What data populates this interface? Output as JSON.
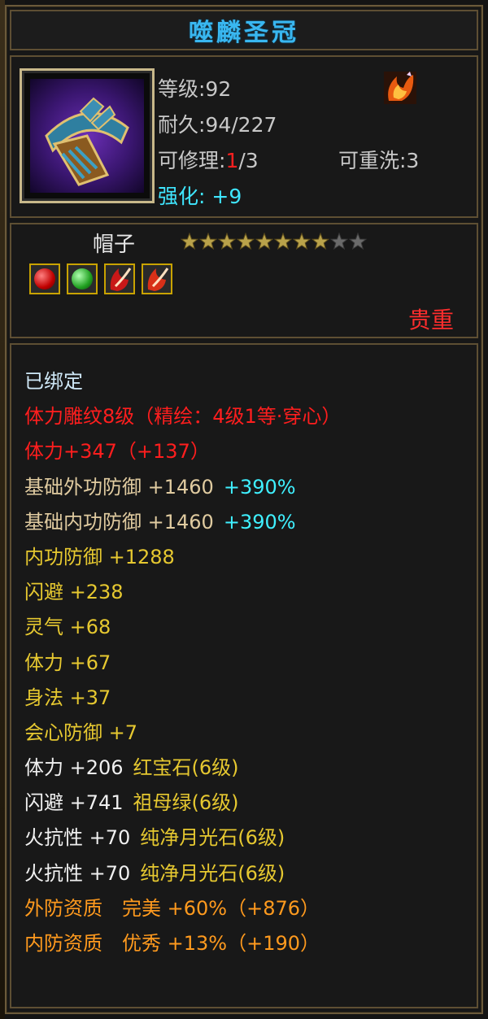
{
  "item": {
    "title": "噬麟圣冠",
    "level_label": "等级:92",
    "durability_label": "耐久:94/227",
    "repair_prefix": "可修理:",
    "repair_current": "1",
    "repair_total": "/3",
    "reforge_label": "可重洗:3",
    "enhance_label": "强化:",
    "enhance_value": "+9",
    "category": "帽子",
    "stars_filled": 8,
    "stars_total": 10,
    "gems": [
      "red-gem-icon",
      "green-gem-icon",
      "red-flame-gem-icon",
      "red-flame-gem-icon"
    ],
    "rarity": "贵重",
    "colors": {
      "title": "#39b7f0",
      "rarity": "#ff2d2d",
      "enhance": "#3fe6ff"
    }
  },
  "attributes": [
    {
      "text": "已绑定",
      "color": "bound"
    },
    {
      "text": "体力雕纹8级（精绘：4级1等·穿心）",
      "color": "red"
    },
    {
      "text": "体力+347（+137）",
      "color": "red"
    },
    {
      "text": "基础外功防御 +1460",
      "extra": "+390%",
      "color": "tan"
    },
    {
      "text": "基础内功防御 +1460",
      "extra": "+390%",
      "color": "tan"
    },
    {
      "text": "内功防御 +1288",
      "color": "yellow"
    },
    {
      "text": "闪避 +238",
      "color": "yellow"
    },
    {
      "text": "灵气 +68",
      "color": "yellow"
    },
    {
      "text": "体力 +67",
      "color": "yellow"
    },
    {
      "text": "身法 +37",
      "color": "yellow"
    },
    {
      "text": "会心防御 +7",
      "color": "yellow"
    },
    {
      "text": "体力 +206",
      "extra": "红宝石(6级)",
      "color": "white"
    },
    {
      "text": "闪避 +741",
      "extra": "祖母绿(6级)",
      "color": "white"
    },
    {
      "text": "火抗性 +70",
      "extra": "纯净月光石(6级)",
      "color": "white"
    },
    {
      "text": "火抗性 +70",
      "extra": "纯净月光石(6级)",
      "color": "white"
    },
    {
      "text": "外防资质　完美 +60%（+876）",
      "color": "orange"
    },
    {
      "text": "内防资质　优秀 +13%（+190）",
      "color": "orange"
    }
  ]
}
